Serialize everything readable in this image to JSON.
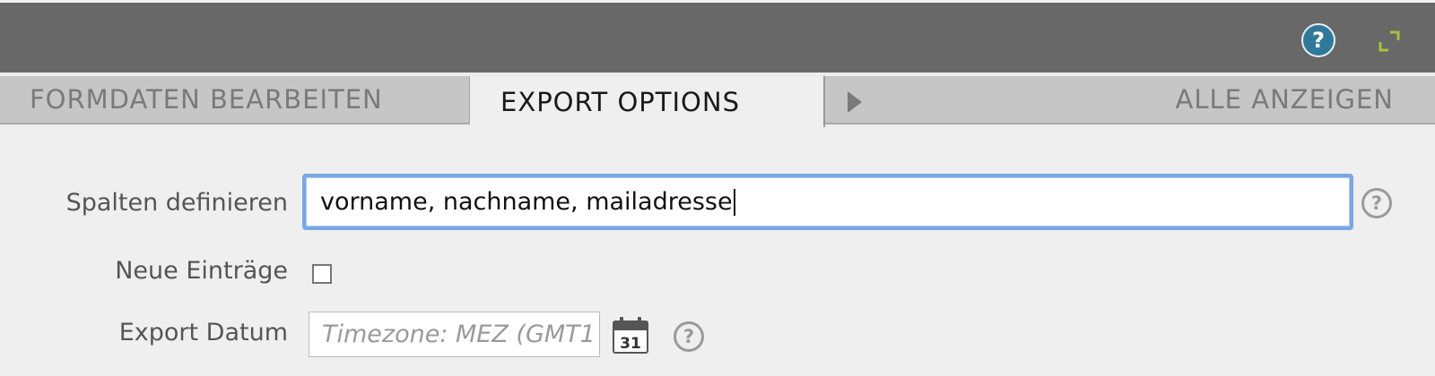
{
  "header": {
    "help_icon": "question-mark",
    "fullscreen_icon": "expand-corners"
  },
  "tabs": {
    "edit_label": "FORMDATEN BEARBEITEN",
    "export_label": "EXPORT OPTIONS",
    "all_label": "ALLE ANZEIGEN",
    "active": "EXPORT OPTIONS"
  },
  "form": {
    "columns": {
      "label": "Spalten definieren",
      "value": "vorname, nachname, mailadresse"
    },
    "new_entries": {
      "label": "Neue Einträge",
      "checked": false
    },
    "export_date": {
      "label": "Export Datum",
      "placeholder": "Timezone: MEZ (GMT1",
      "calendar_day": "31"
    },
    "help_glyph": "?"
  },
  "colors": {
    "topbar": "#686868",
    "help_accent": "#2f7a9a",
    "fullscreen_accent": "#a6c23a",
    "focus_ring": "#7aa8e6"
  }
}
